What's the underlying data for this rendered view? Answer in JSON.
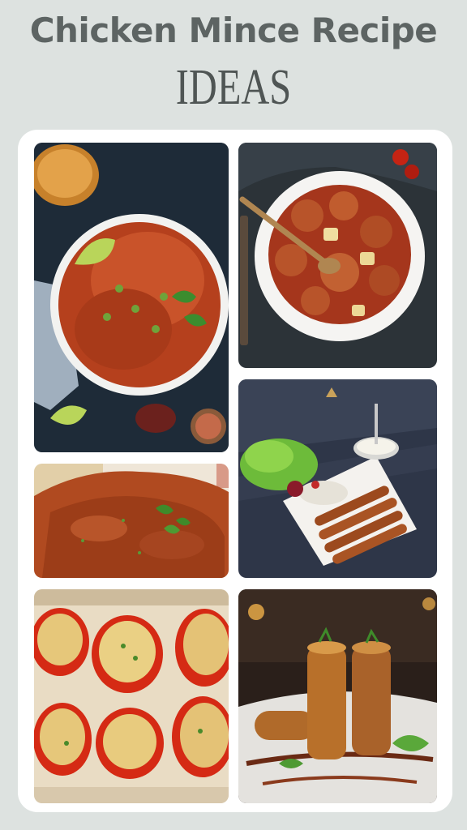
{
  "header": {
    "title": "Chicken Mince Recipe",
    "subtitle": "IDEAS"
  },
  "decorations": {
    "sparkle_glyph": "✦"
  },
  "photos": [
    {
      "name": "keema-peas-rice-bowl"
    },
    {
      "name": "meatball-potato-curry"
    },
    {
      "name": "seekh-kebab-platter"
    },
    {
      "name": "chicken-keema-curry"
    },
    {
      "name": "stuffed-bell-peppers"
    },
    {
      "name": "spring-rolls-plate"
    }
  ]
}
